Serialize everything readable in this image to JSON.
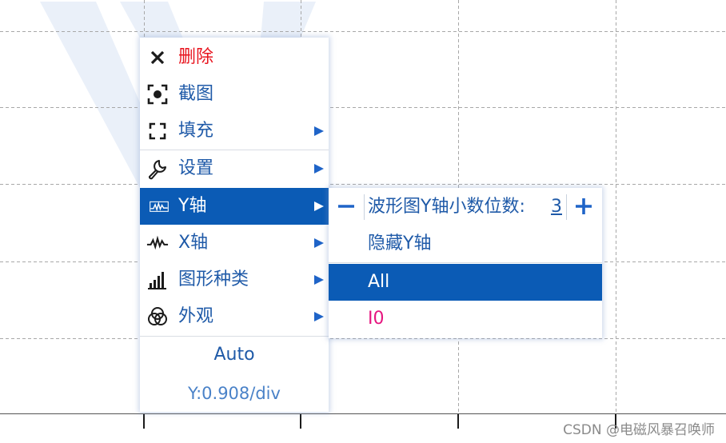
{
  "main_menu": {
    "items": [
      {
        "label": "删除",
        "icon": "close-icon",
        "color": "#e8141e",
        "has_submenu": false
      },
      {
        "label": "截图",
        "icon": "screenshot-icon",
        "color": "#1f5aa8",
        "has_submenu": false
      },
      {
        "label": "填充",
        "icon": "fill-frame-icon",
        "color": "#1f5aa8",
        "has_submenu": true
      },
      {
        "label": "设置",
        "icon": "wrench-icon",
        "color": "#1f5aa8",
        "has_submenu": true
      },
      {
        "label": "Y轴",
        "icon": "waveform-icon",
        "color": "#ffffff",
        "has_submenu": true,
        "selected": true
      },
      {
        "label": "X轴",
        "icon": "waveform-icon",
        "color": "#1f5aa8",
        "has_submenu": true
      },
      {
        "label": "图形种类",
        "icon": "bar-chart-icon",
        "color": "#1f5aa8",
        "has_submenu": true
      },
      {
        "label": "外观",
        "icon": "palette-circles-icon",
        "color": "#1f5aa8",
        "has_submenu": true
      }
    ],
    "auto_label": "Auto",
    "scale_readout": "Y:0.908/div"
  },
  "y_axis_submenu": {
    "decimal_label": "波形图Y轴小数位数:",
    "decimal_value": "3",
    "minus_symbol": "−",
    "plus_symbol": "+",
    "hide_label": "隐藏Y轴",
    "channels": [
      {
        "label": "All",
        "selected": true,
        "color": "#ffffff"
      },
      {
        "label": "I0",
        "selected": false,
        "color": "#e6157f"
      }
    ]
  },
  "watermark": "CSDN @电磁风暴召唤师",
  "colors": {
    "menu_text": "#1f5aa8",
    "selection": "#0b5bb5",
    "delete_red": "#e8141e",
    "channel_pink": "#e6157f",
    "grid": "#a8a8a8"
  }
}
